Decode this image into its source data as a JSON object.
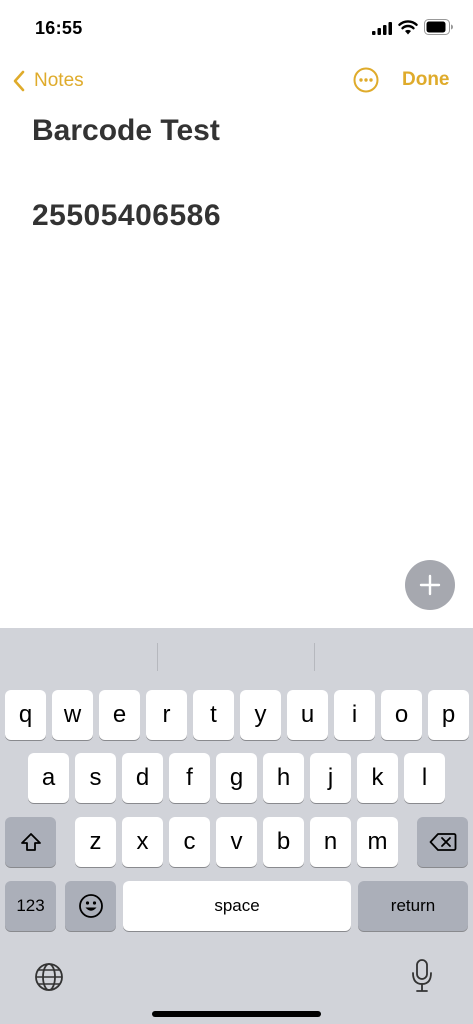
{
  "status_bar": {
    "time": "16:55"
  },
  "nav": {
    "back_label": "Notes",
    "done_label": "Done"
  },
  "note": {
    "title": "Barcode Test",
    "body": "25505406586"
  },
  "keyboard": {
    "row1": [
      "q",
      "w",
      "e",
      "r",
      "t",
      "y",
      "u",
      "i",
      "o",
      "p"
    ],
    "row2": [
      "a",
      "s",
      "d",
      "f",
      "g",
      "h",
      "j",
      "k",
      "l"
    ],
    "row3": [
      "z",
      "x",
      "c",
      "v",
      "b",
      "n",
      "m"
    ],
    "numbers_label": "123",
    "space_label": "space",
    "return_label": "return"
  },
  "colors": {
    "accent": "#dfab2b",
    "text": "#333333",
    "keyboard_bg": "#d1d3d9",
    "dark_key": "#abafb9"
  }
}
